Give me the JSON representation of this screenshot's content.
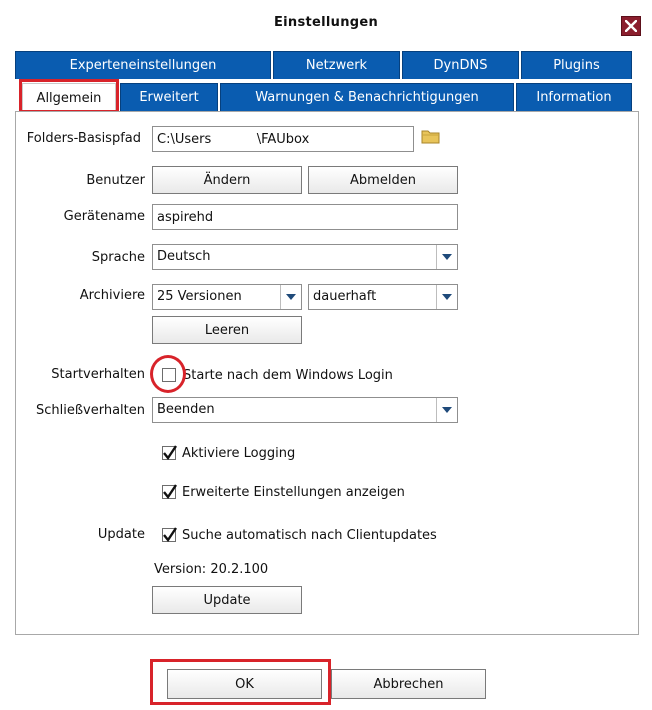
{
  "window": {
    "title": "Einstellungen"
  },
  "tabs_row1": [
    "Experteneinstellungen",
    "Netzwerk",
    "DynDNS",
    "Plugins"
  ],
  "tabs_row2": [
    "Allgemein",
    "Erweitert",
    "Warnungen & Benachrichtigungen",
    "Information"
  ],
  "active_tab": "Allgemein",
  "general": {
    "folders_label": "Folders-Basispfad",
    "folders_value": "C:\\Users           \\FAUbox",
    "benutzer_label": "Benutzer",
    "aendern_button": "Ändern",
    "abmelden_button": "Abmelden",
    "geraetename_label": "Gerätename",
    "geraetename_value": "aspirehd",
    "sprache_label": "Sprache",
    "sprache_value": "Deutsch",
    "archiviere_label": "Archiviere",
    "versionen_value": "25 Versionen",
    "dauer_value": "dauerhaft",
    "leeren_button": "Leeren",
    "startverhalten_label": "Startverhalten",
    "start_login_label": "Starte nach dem Windows Login",
    "start_login_checked": false,
    "schliessverhalten_label": "Schließverhalten",
    "schliessverhalten_value": "Beenden",
    "logging_label": "Aktiviere Logging",
    "logging_checked": true,
    "erweiterte_label": "Erweiterte Einstellungen anzeigen",
    "erweiterte_checked": true,
    "update_label": "Update",
    "autoupdate_label": "Suche automatisch nach Clientupdates",
    "autoupdate_checked": true,
    "version_text": "Version: 20.2.100",
    "update_button": "Update"
  },
  "footer": {
    "ok_button": "OK",
    "cancel_button": "Abbrechen"
  },
  "colors": {
    "tab_blue": "#0a5cb0",
    "highlight_red": "#d8232a",
    "close_red": "#8b1e2d"
  }
}
